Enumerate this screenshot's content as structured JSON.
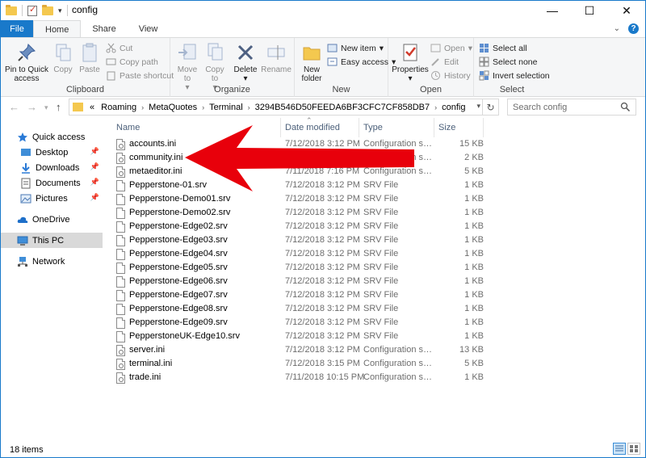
{
  "window": {
    "title": "config",
    "minimize_glyph": "—",
    "maximize_glyph": "☐",
    "close_glyph": "✕"
  },
  "tabs": [
    {
      "label": "File"
    },
    {
      "label": "Home"
    },
    {
      "label": "Share"
    },
    {
      "label": "View"
    }
  ],
  "ribbon": {
    "clipboard": {
      "label": "Clipboard",
      "pin": "Pin to Quick access",
      "copy": "Copy",
      "paste": "Paste",
      "cut": "Cut",
      "copy_path": "Copy path",
      "paste_shortcut": "Paste shortcut"
    },
    "organize": {
      "label": "Organize",
      "move_to": "Move to",
      "copy_to": "Copy to",
      "delete": "Delete",
      "rename": "Rename"
    },
    "new": {
      "label": "New",
      "new_folder": "New folder",
      "new_item": "New item",
      "easy_access": "Easy access"
    },
    "open": {
      "label": "Open",
      "properties": "Properties",
      "open": "Open",
      "edit": "Edit",
      "history": "History"
    },
    "select": {
      "label": "Select",
      "select_all": "Select all",
      "select_none": "Select none",
      "invert_selection": "Invert selection"
    }
  },
  "address": {
    "overflow": "«",
    "segments": [
      "Roaming",
      "MetaQuotes",
      "Terminal",
      "3294B546D50FEEDA6BF3CFC7CF858DB7",
      "config"
    ],
    "search_placeholder": "Search config"
  },
  "nav": {
    "items": [
      {
        "label": "Quick access"
      },
      {
        "label": "Desktop"
      },
      {
        "label": "Downloads"
      },
      {
        "label": "Documents"
      },
      {
        "label": "Pictures"
      },
      {
        "label": "OneDrive"
      },
      {
        "label": "This PC"
      },
      {
        "label": "Network"
      }
    ]
  },
  "columns": {
    "name": "Name",
    "date": "Date modified",
    "type": "Type",
    "size": "Size"
  },
  "files": [
    {
      "name": "accounts.ini",
      "date": "7/12/2018 3:12 PM",
      "type": "Configuration settings",
      "size": "15 KB"
    },
    {
      "name": "community.ini",
      "date": "7/12/2018 3:12 PM",
      "type": "Configuration settings",
      "size": "2 KB"
    },
    {
      "name": "metaeditor.ini",
      "date": "7/11/2018 7:16 PM",
      "type": "Configuration settings",
      "size": "5 KB"
    },
    {
      "name": "Pepperstone-01.srv",
      "date": "7/12/2018 3:12 PM",
      "type": "SRV File",
      "size": "1 KB"
    },
    {
      "name": "Pepperstone-Demo01.srv",
      "date": "7/12/2018 3:12 PM",
      "type": "SRV File",
      "size": "1 KB"
    },
    {
      "name": "Pepperstone-Demo02.srv",
      "date": "7/12/2018 3:12 PM",
      "type": "SRV File",
      "size": "1 KB"
    },
    {
      "name": "Pepperstone-Edge02.srv",
      "date": "7/12/2018 3:12 PM",
      "type": "SRV File",
      "size": "1 KB"
    },
    {
      "name": "Pepperstone-Edge03.srv",
      "date": "7/12/2018 3:12 PM",
      "type": "SRV File",
      "size": "1 KB"
    },
    {
      "name": "Pepperstone-Edge04.srv",
      "date": "7/12/2018 3:12 PM",
      "type": "SRV File",
      "size": "1 KB"
    },
    {
      "name": "Pepperstone-Edge05.srv",
      "date": "7/12/2018 3:12 PM",
      "type": "SRV File",
      "size": "1 KB"
    },
    {
      "name": "Pepperstone-Edge06.srv",
      "date": "7/12/2018 3:12 PM",
      "type": "SRV File",
      "size": "1 KB"
    },
    {
      "name": "Pepperstone-Edge07.srv",
      "date": "7/12/2018 3:12 PM",
      "type": "SRV File",
      "size": "1 KB"
    },
    {
      "name": "Pepperstone-Edge08.srv",
      "date": "7/12/2018 3:12 PM",
      "type": "SRV File",
      "size": "1 KB"
    },
    {
      "name": "Pepperstone-Edge09.srv",
      "date": "7/12/2018 3:12 PM",
      "type": "SRV File",
      "size": "1 KB"
    },
    {
      "name": "PepperstoneUK-Edge10.srv",
      "date": "7/12/2018 3:12 PM",
      "type": "SRV File",
      "size": "1 KB"
    },
    {
      "name": "server.ini",
      "date": "7/12/2018 3:12 PM",
      "type": "Configuration settings",
      "size": "13 KB"
    },
    {
      "name": "terminal.ini",
      "date": "7/12/2018 3:15 PM",
      "type": "Configuration settings",
      "size": "5 KB"
    },
    {
      "name": "trade.ini",
      "date": "7/11/2018 10:15 PM",
      "type": "Configuration settings",
      "size": "1 KB"
    }
  ],
  "status": {
    "item_count": "18 items"
  },
  "colors": {
    "accent": "#1979ca",
    "annotation_arrow": "#e8000b"
  }
}
